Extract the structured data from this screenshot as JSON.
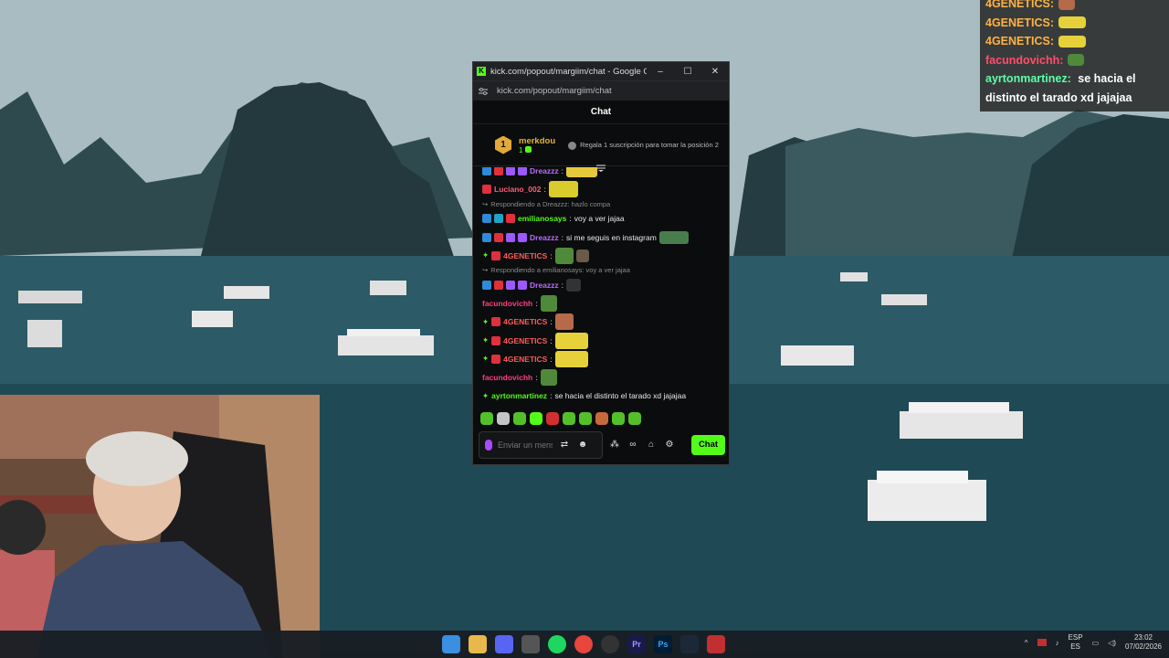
{
  "browser": {
    "window_title": "kick.com/popout/margiim/chat - Google Chrome",
    "url": "kick.com/popout/margiim/chat",
    "minimize": "–",
    "maximize": "☐",
    "close": "✕"
  },
  "kick": {
    "header": "Chat",
    "pinned": {
      "rank": "1",
      "user": "merkdou",
      "count": "1",
      "gift_text": "Regala 1 suscripción para tomar la posición 2"
    },
    "messages": [
      {
        "user": "Dreazzz",
        "color": "#b86cff",
        "text": ""
      },
      {
        "user": "Luciano_002",
        "color": "#ff5d7a",
        "text": ""
      },
      {
        "reply": "Respondiendo a Dreazzz: hazlo compa"
      },
      {
        "user": "emilianosays",
        "color": "#53fc18",
        "text": "voy a ver jajaa"
      },
      {
        "user": "Dreazzz",
        "color": "#b86cff",
        "text": "si me seguis en instagram"
      },
      {
        "user": "4GENETICS",
        "color": "#ff5b5b",
        "text": ""
      },
      {
        "reply": "Respondiendo a emilianosays: voy a ver jajaa"
      },
      {
        "user": "Dreazzz",
        "color": "#b86cff",
        "text": ""
      },
      {
        "user": "facundovichh",
        "color": "#ff3d7f",
        "text": ""
      },
      {
        "user": "4GENETICS",
        "color": "#ff5b5b",
        "text": ""
      },
      {
        "user": "4GENETICS",
        "color": "#ff5b5b",
        "text": ""
      },
      {
        "user": "4GENETICS",
        "color": "#ff5b5b",
        "text": ""
      },
      {
        "user": "facundovichh",
        "color": "#ff3d7f",
        "text": ""
      },
      {
        "user": "ayrtonmartinez",
        "color": "#53fc18",
        "text": "se hacia el distinto el tarado xd jajajaa"
      }
    ],
    "input_placeholder": "Enviar un mensaje",
    "chat_button": "Chat"
  },
  "overlay_chat": [
    {
      "user": "4GENETICS:",
      "color": "#ffb340",
      "text": ""
    },
    {
      "user": "4GENETICS:",
      "color": "#ffb340",
      "text": ""
    },
    {
      "user": "4GENETICS:",
      "color": "#ffb340",
      "text": ""
    },
    {
      "user": "facundovichh:",
      "color": "#ff4d6a",
      "text": ""
    },
    {
      "user": "ayrtonmartinez:",
      "color": "#5dffa8",
      "text": "se hacia el distinto el tarado xd jajajaa"
    }
  ],
  "tray": {
    "lang_top": "ESP",
    "lang_bottom": "ES",
    "time": "23:02",
    "date": "07/02/2026"
  },
  "colors": {
    "kick_green": "#53fc18",
    "window_bg": "#0b0c0d"
  }
}
